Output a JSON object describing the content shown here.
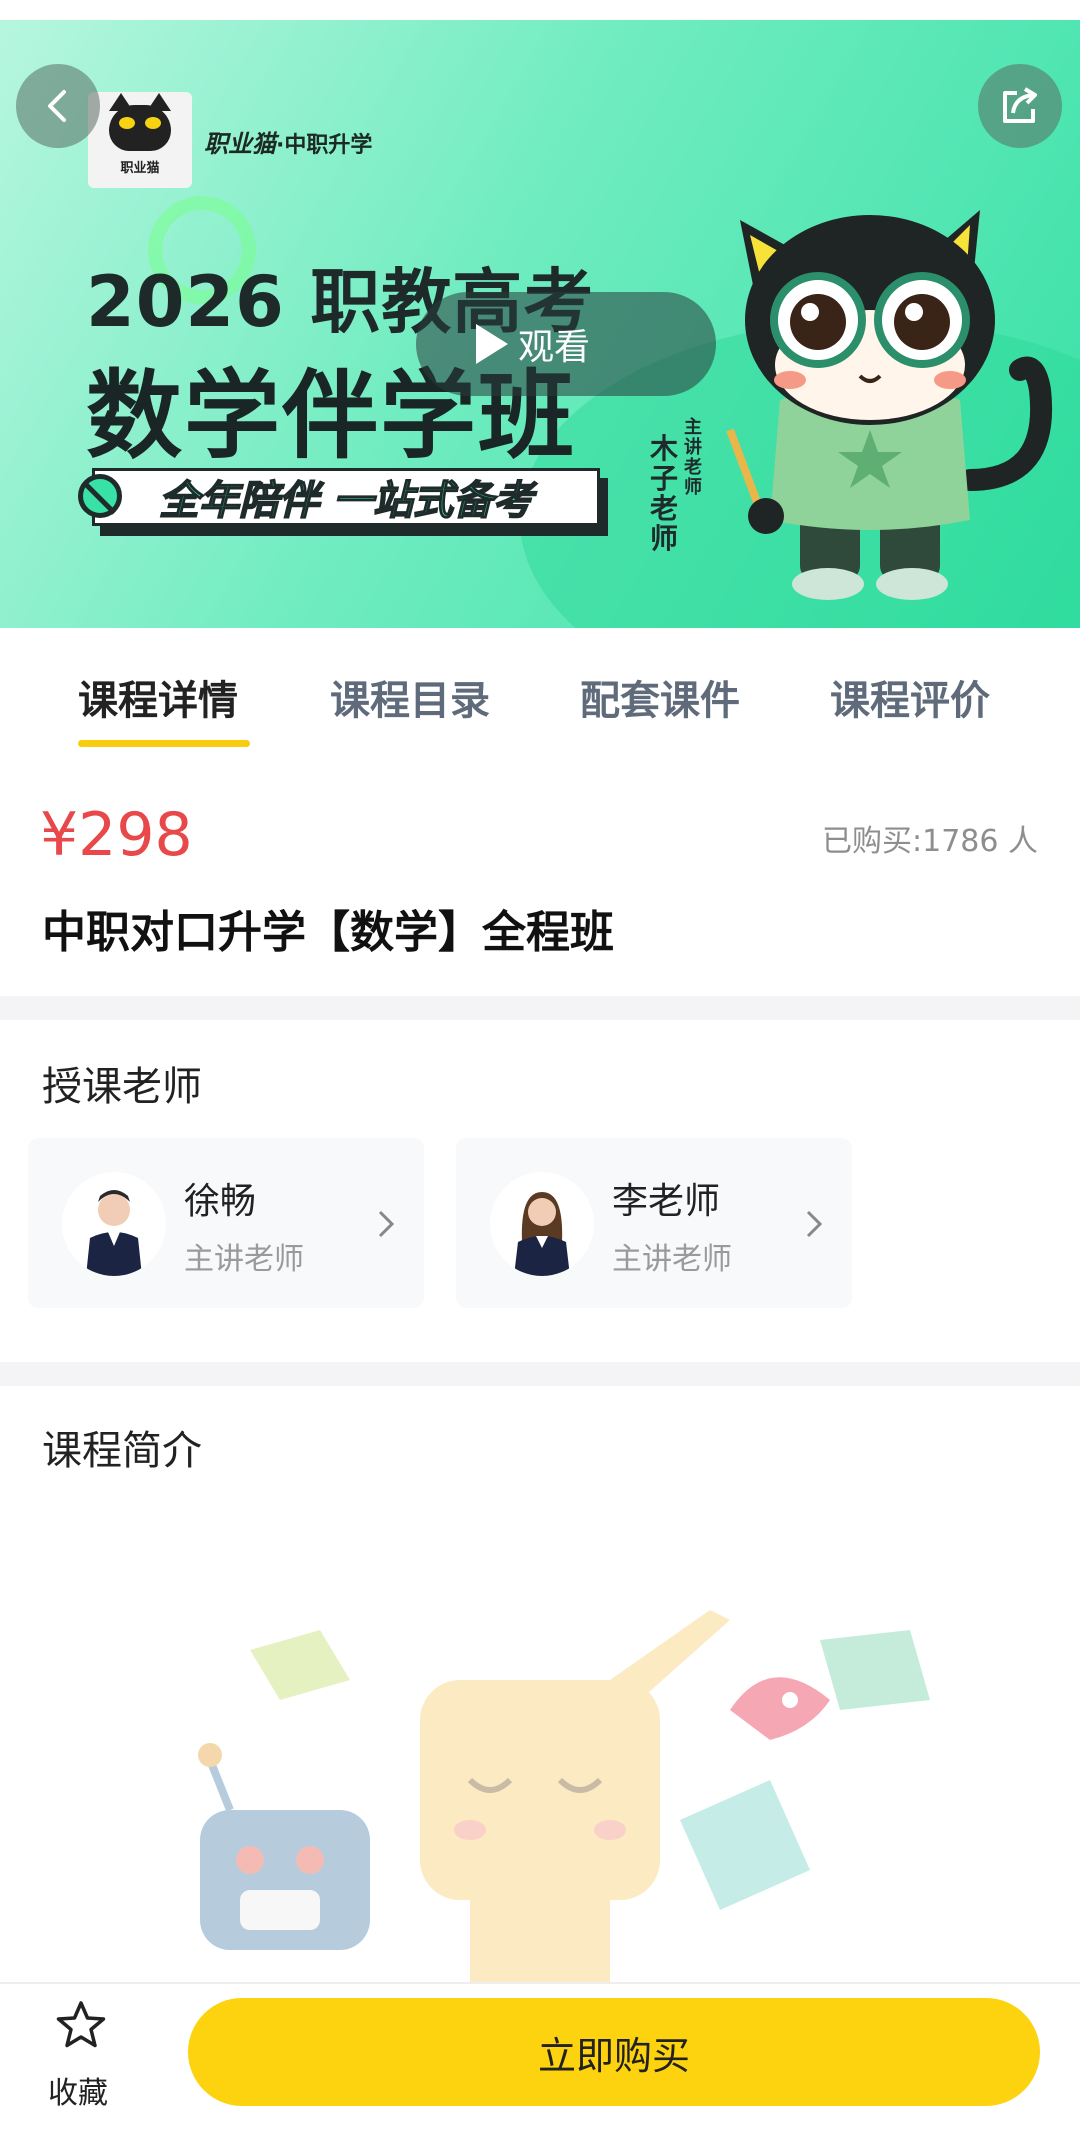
{
  "banner": {
    "logo_text": "职业猫",
    "brand_name": "职业猫",
    "brand_sub": "·中职升学",
    "year_title": "2026 职教高考",
    "main_title": "数学伴学班",
    "slogan": "全年陪伴 一站式备考",
    "teacher_role_vertical": "主讲老师",
    "teacher_name_vertical": "木子老师",
    "watch_label": "观看"
  },
  "tabs": [
    {
      "label": "课程详情",
      "active": true
    },
    {
      "label": "课程目录",
      "active": false
    },
    {
      "label": "配套课件",
      "active": false
    },
    {
      "label": "课程评价",
      "active": false
    }
  ],
  "course": {
    "price": "¥298",
    "sold": "已购买:1786 人",
    "title": "中职对口升学【数学】全程班"
  },
  "teachers_section": {
    "title": "授课老师",
    "teachers": [
      {
        "name": "徐畅",
        "role": "主讲老师"
      },
      {
        "name": "李老师",
        "role": "主讲老师"
      }
    ]
  },
  "intro_section": {
    "title": "课程简介"
  },
  "bottom_bar": {
    "favorite_label": "收藏",
    "buy_label": "立即购买"
  },
  "colors": {
    "accent_yellow": "#fdd20e",
    "price_red": "#e8484a",
    "banner_green": "#37e0a6"
  },
  "icons": [
    "back-icon",
    "share-icon",
    "play-icon",
    "chevron-right-icon",
    "star-icon"
  ]
}
